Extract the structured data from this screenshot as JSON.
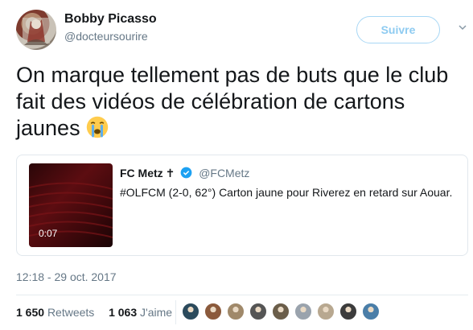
{
  "author": {
    "name": "Bobby Picasso",
    "handle": "@docteursourire"
  },
  "follow_button": {
    "label": "Suivre"
  },
  "tweet": {
    "text": "On marque tellement pas de buts que le club fait des vidéos de célébration de cartons jaunes",
    "emoji": "crying-face-emoji"
  },
  "quoted_tweet": {
    "name": "FC Metz",
    "name_suffix": "✝",
    "handle": "@FCMetz",
    "text": "#OLFCM (2-0, 62°) Carton jaune pour Riverez en retard  sur Aouar.",
    "video_duration": "0:07",
    "verified": true
  },
  "timestamp": "12:18 - 29 oct. 2017",
  "stats": {
    "retweets_count": "1 650",
    "retweets_label": "Retweets",
    "likes_count": "1 063",
    "likes_label": "J'aime"
  },
  "likers": [
    {
      "color": "#2b4a5c"
    },
    {
      "color": "#8b5a3c"
    },
    {
      "color": "#a0896a"
    },
    {
      "color": "#555555"
    },
    {
      "color": "#6b5e4a"
    },
    {
      "color": "#9aa3ad"
    },
    {
      "color": "#b8a890"
    },
    {
      "color": "#3c3c3c"
    },
    {
      "color": "#4a7ea8"
    }
  ],
  "colors": {
    "accent": "#1da1f2",
    "text_primary": "#14171a",
    "text_secondary": "#657786"
  }
}
